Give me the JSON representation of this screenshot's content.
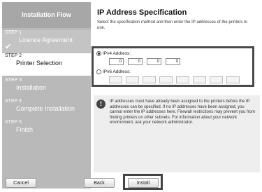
{
  "sidebar": {
    "title": "Installation Flow",
    "steps": [
      {
        "num": "STEP 1",
        "name": "Licence Agreement"
      },
      {
        "num": "STEP 2",
        "name": "Printer Selection"
      },
      {
        "num": "STEP 3",
        "name": "Installation"
      },
      {
        "num": "STEP 4",
        "name": "Complete Installation"
      },
      {
        "num": "STEP 5",
        "name": "Finish"
      }
    ]
  },
  "main": {
    "title": "IP Address Specification",
    "subtitle": "Select the specification method and then enter the IP addresses of the printers to use.",
    "ipv4": {
      "label": "IPv4 Address:",
      "octets": [
        "0",
        "0",
        "0",
        "0"
      ],
      "selected": true
    },
    "ipv6": {
      "label": "IPv6 Address:",
      "selected": false
    },
    "note": "IP addresses must have already been assigned to the printers before the IP addresses can be specified. If no IP addresses have been assigned, you cannot enter the IP addresses here. Firewall restrictions may prevent you from finding printers on other subnets. For information about your network environment, ask your network administrator."
  },
  "buttons": {
    "cancel": "Cancel",
    "back": "Back",
    "install": "Install"
  },
  "colors": {
    "sidebar": "#b9b9b9",
    "highlight_border": "#4a4a4a"
  }
}
